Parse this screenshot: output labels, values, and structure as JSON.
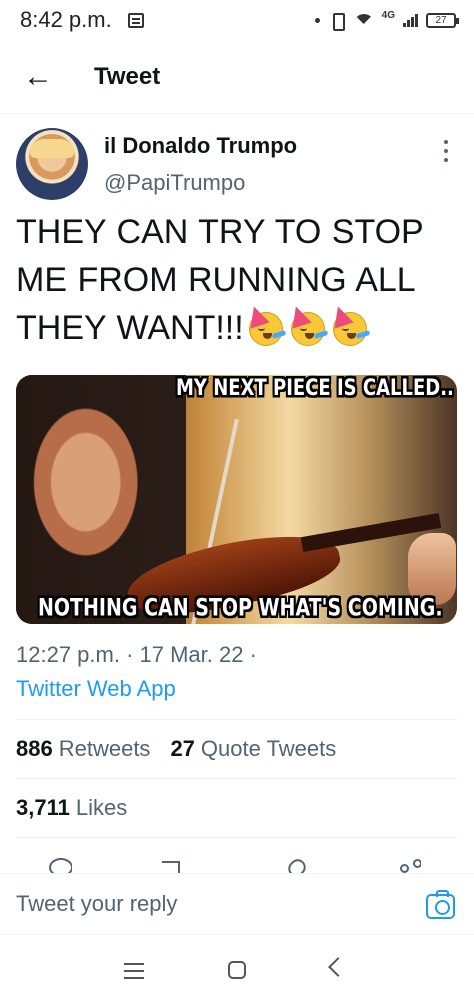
{
  "status_bar": {
    "time": "8:42 p.m.",
    "network": "4G",
    "battery": "27"
  },
  "header": {
    "title": "Tweet"
  },
  "tweet": {
    "author_name": "il Donaldo Trumpo",
    "author_handle": "@PapiTrumpo",
    "text": "THEY CAN TRY TO STOP ME FROM RUNNING ALL THEY WANT!!!",
    "emoji": [
      "🥳",
      "🥳",
      "🥳"
    ],
    "image": {
      "top_text": "MY NEXT PIECE IS CALLED..",
      "bottom_text": "NOTHING CAN STOP WHAT'S COMING."
    },
    "timestamp": "12:27 p.m. · 17 Mar. 22 ·",
    "source": "Twitter Web App",
    "retweets_count": "886",
    "retweets_label": "Retweets",
    "quote_count": "27",
    "quote_label": "Quote Tweets",
    "likes_count": "3,711",
    "likes_label": "Likes"
  },
  "reply": {
    "placeholder": "Tweet your reply"
  },
  "icons": {
    "back": "arrow-left-icon",
    "more": "more-vertical-icon",
    "reply": "reply-icon",
    "retweet": "retweet-icon",
    "like": "heart-icon",
    "share": "share-icon",
    "camera": "camera-icon",
    "nav_menu": "menu-icon",
    "nav_home": "home-icon",
    "nav_back": "chevron-left-icon"
  },
  "colors": {
    "background": "#ffffff",
    "text": "#0f1419",
    "secondary_text": "#536471",
    "accent": "#1d9bf0",
    "divider": "#eff3f4"
  }
}
